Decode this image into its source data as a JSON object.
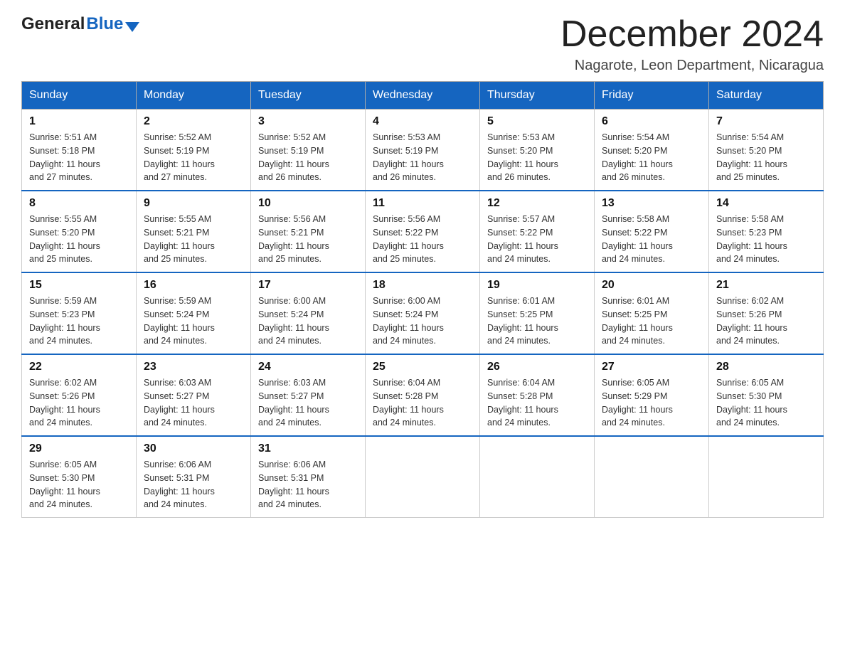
{
  "header": {
    "logo_general": "General",
    "logo_blue": "Blue",
    "month_title": "December 2024",
    "location": "Nagarote, Leon Department, Nicaragua"
  },
  "calendar": {
    "days_of_week": [
      "Sunday",
      "Monday",
      "Tuesday",
      "Wednesday",
      "Thursday",
      "Friday",
      "Saturday"
    ],
    "weeks": [
      [
        {
          "day": "1",
          "sunrise": "5:51 AM",
          "sunset": "5:18 PM",
          "daylight": "11 hours and 27 minutes."
        },
        {
          "day": "2",
          "sunrise": "5:52 AM",
          "sunset": "5:19 PM",
          "daylight": "11 hours and 27 minutes."
        },
        {
          "day": "3",
          "sunrise": "5:52 AM",
          "sunset": "5:19 PM",
          "daylight": "11 hours and 26 minutes."
        },
        {
          "day": "4",
          "sunrise": "5:53 AM",
          "sunset": "5:19 PM",
          "daylight": "11 hours and 26 minutes."
        },
        {
          "day": "5",
          "sunrise": "5:53 AM",
          "sunset": "5:20 PM",
          "daylight": "11 hours and 26 minutes."
        },
        {
          "day": "6",
          "sunrise": "5:54 AM",
          "sunset": "5:20 PM",
          "daylight": "11 hours and 26 minutes."
        },
        {
          "day": "7",
          "sunrise": "5:54 AM",
          "sunset": "5:20 PM",
          "daylight": "11 hours and 25 minutes."
        }
      ],
      [
        {
          "day": "8",
          "sunrise": "5:55 AM",
          "sunset": "5:20 PM",
          "daylight": "11 hours and 25 minutes."
        },
        {
          "day": "9",
          "sunrise": "5:55 AM",
          "sunset": "5:21 PM",
          "daylight": "11 hours and 25 minutes."
        },
        {
          "day": "10",
          "sunrise": "5:56 AM",
          "sunset": "5:21 PM",
          "daylight": "11 hours and 25 minutes."
        },
        {
          "day": "11",
          "sunrise": "5:56 AM",
          "sunset": "5:22 PM",
          "daylight": "11 hours and 25 minutes."
        },
        {
          "day": "12",
          "sunrise": "5:57 AM",
          "sunset": "5:22 PM",
          "daylight": "11 hours and 24 minutes."
        },
        {
          "day": "13",
          "sunrise": "5:58 AM",
          "sunset": "5:22 PM",
          "daylight": "11 hours and 24 minutes."
        },
        {
          "day": "14",
          "sunrise": "5:58 AM",
          "sunset": "5:23 PM",
          "daylight": "11 hours and 24 minutes."
        }
      ],
      [
        {
          "day": "15",
          "sunrise": "5:59 AM",
          "sunset": "5:23 PM",
          "daylight": "11 hours and 24 minutes."
        },
        {
          "day": "16",
          "sunrise": "5:59 AM",
          "sunset": "5:24 PM",
          "daylight": "11 hours and 24 minutes."
        },
        {
          "day": "17",
          "sunrise": "6:00 AM",
          "sunset": "5:24 PM",
          "daylight": "11 hours and 24 minutes."
        },
        {
          "day": "18",
          "sunrise": "6:00 AM",
          "sunset": "5:24 PM",
          "daylight": "11 hours and 24 minutes."
        },
        {
          "day": "19",
          "sunrise": "6:01 AM",
          "sunset": "5:25 PM",
          "daylight": "11 hours and 24 minutes."
        },
        {
          "day": "20",
          "sunrise": "6:01 AM",
          "sunset": "5:25 PM",
          "daylight": "11 hours and 24 minutes."
        },
        {
          "day": "21",
          "sunrise": "6:02 AM",
          "sunset": "5:26 PM",
          "daylight": "11 hours and 24 minutes."
        }
      ],
      [
        {
          "day": "22",
          "sunrise": "6:02 AM",
          "sunset": "5:26 PM",
          "daylight": "11 hours and 24 minutes."
        },
        {
          "day": "23",
          "sunrise": "6:03 AM",
          "sunset": "5:27 PM",
          "daylight": "11 hours and 24 minutes."
        },
        {
          "day": "24",
          "sunrise": "6:03 AM",
          "sunset": "5:27 PM",
          "daylight": "11 hours and 24 minutes."
        },
        {
          "day": "25",
          "sunrise": "6:04 AM",
          "sunset": "5:28 PM",
          "daylight": "11 hours and 24 minutes."
        },
        {
          "day": "26",
          "sunrise": "6:04 AM",
          "sunset": "5:28 PM",
          "daylight": "11 hours and 24 minutes."
        },
        {
          "day": "27",
          "sunrise": "6:05 AM",
          "sunset": "5:29 PM",
          "daylight": "11 hours and 24 minutes."
        },
        {
          "day": "28",
          "sunrise": "6:05 AM",
          "sunset": "5:30 PM",
          "daylight": "11 hours and 24 minutes."
        }
      ],
      [
        {
          "day": "29",
          "sunrise": "6:05 AM",
          "sunset": "5:30 PM",
          "daylight": "11 hours and 24 minutes."
        },
        {
          "day": "30",
          "sunrise": "6:06 AM",
          "sunset": "5:31 PM",
          "daylight": "11 hours and 24 minutes."
        },
        {
          "day": "31",
          "sunrise": "6:06 AM",
          "sunset": "5:31 PM",
          "daylight": "11 hours and 24 minutes."
        },
        null,
        null,
        null,
        null
      ]
    ],
    "labels": {
      "sunrise": "Sunrise:",
      "sunset": "Sunset:",
      "daylight": "Daylight:"
    }
  }
}
